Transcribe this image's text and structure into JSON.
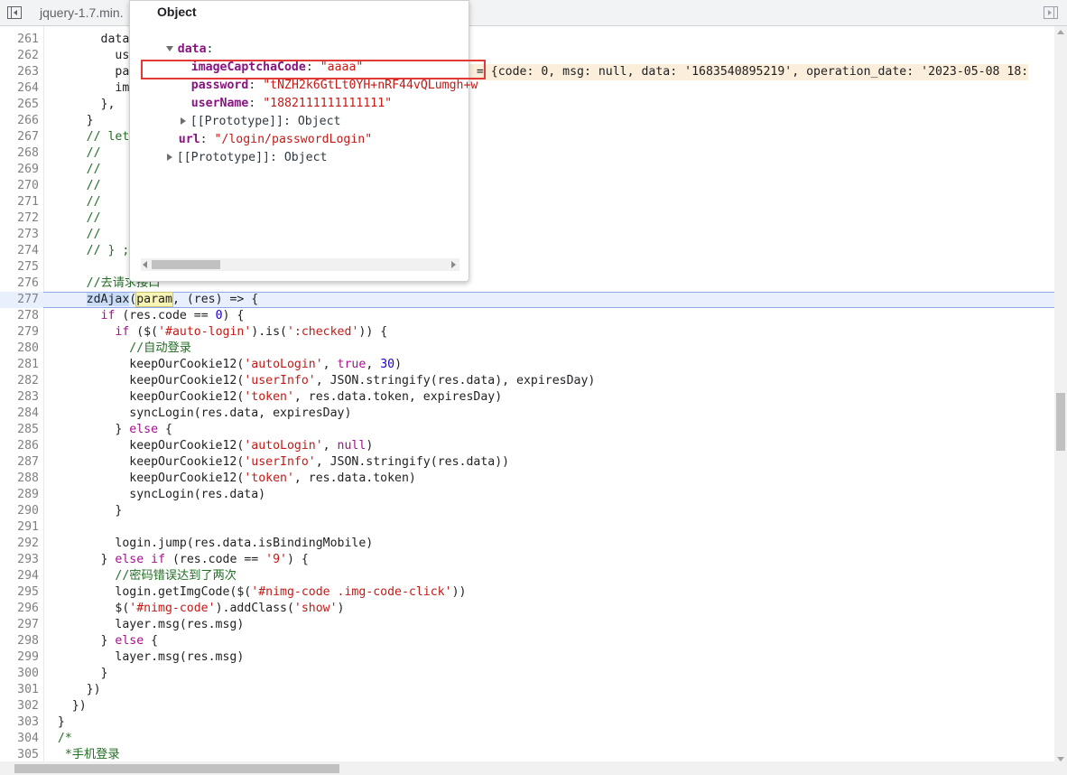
{
  "tab": {
    "file_name": "jquery-1.7.min."
  },
  "popover": {
    "title": "Object",
    "data_key": "data",
    "captcha_key": "imageCaptchaCode",
    "captcha_value": "\"aaaa\"",
    "password_key": "password",
    "password_value": "\"tNZH2k6GtLt0YH+nRF44vQLumgh+w",
    "username_key": "userName",
    "username_value": "\"1882111111111111\"",
    "proto_inner": "[[Prototype]]: Object",
    "url_key": "url",
    "url_value": "\"/login/passwordLogin\"",
    "proto_outer": "[[Prototype]]: Object"
  },
  "eval_hint": "s = {code: 0, msg: null, data: '1683540895219', operation_date: '2023-05-08 18:",
  "lines": [
    {
      "n": "261",
      "t": "        data"
    },
    {
      "n": "262",
      "t": "          us"
    },
    {
      "n": "263",
      "t": "          pa"
    },
    {
      "n": "264",
      "t": "          im"
    },
    {
      "n": "265",
      "t": "        },"
    },
    {
      "n": "266",
      "t": "      }"
    },
    {
      "n": "267",
      "t": "      // let"
    },
    {
      "n": "268",
      "t": "      //"
    },
    {
      "n": "269",
      "t": "      //"
    },
    {
      "n": "270",
      "t": "      //"
    },
    {
      "n": "271",
      "t": "      //"
    },
    {
      "n": "272",
      "t": "      //"
    },
    {
      "n": "273",
      "t": "      //"
    },
    {
      "n": "274",
      "t": "      // } ;"
    },
    {
      "n": "275",
      "t": ""
    },
    {
      "n": "276",
      "t": "      //去请求接口"
    },
    {
      "n": "277",
      "t": "      zdAjax(param, (res) => {"
    },
    {
      "n": "278",
      "t": "        if (res.code == 0) {"
    },
    {
      "n": "279",
      "t": "          if ($('#auto-login').is(':checked')) {"
    },
    {
      "n": "280",
      "t": "            //自动登录"
    },
    {
      "n": "281",
      "t": "            keepOurCookie12('autoLogin', true, 30)"
    },
    {
      "n": "282",
      "t": "            keepOurCookie12('userInfo', JSON.stringify(res.data), expiresDay)"
    },
    {
      "n": "283",
      "t": "            keepOurCookie12('token', res.data.token, expiresDay)"
    },
    {
      "n": "284",
      "t": "            syncLogin(res.data, expiresDay)"
    },
    {
      "n": "285",
      "t": "          } else {"
    },
    {
      "n": "286",
      "t": "            keepOurCookie12('autoLogin', null)"
    },
    {
      "n": "287",
      "t": "            keepOurCookie12('userInfo', JSON.stringify(res.data))"
    },
    {
      "n": "288",
      "t": "            keepOurCookie12('token', res.data.token)"
    },
    {
      "n": "289",
      "t": "            syncLogin(res.data)"
    },
    {
      "n": "290",
      "t": "          }"
    },
    {
      "n": "291",
      "t": ""
    },
    {
      "n": "292",
      "t": "          login.jump(res.data.isBindingMobile)"
    },
    {
      "n": "293",
      "t": "        } else if (res.code == '9') {"
    },
    {
      "n": "294",
      "t": "          //密码错误达到了两次"
    },
    {
      "n": "295",
      "t": "          login.getImgCode($('#nimg-code .img-code-click'))"
    },
    {
      "n": "296",
      "t": "          $('#nimg-code').addClass('show')"
    },
    {
      "n": "297",
      "t": "          layer.msg(res.msg)"
    },
    {
      "n": "298",
      "t": "        } else {"
    },
    {
      "n": "299",
      "t": "          layer.msg(res.msg)"
    },
    {
      "n": "300",
      "t": "        }"
    },
    {
      "n": "301",
      "t": "      })"
    },
    {
      "n": "302",
      "t": "    })"
    },
    {
      "n": "303",
      "t": "  }"
    },
    {
      "n": "304",
      "t": "  /*"
    },
    {
      "n": "305",
      "t": "   *手机登录"
    }
  ]
}
